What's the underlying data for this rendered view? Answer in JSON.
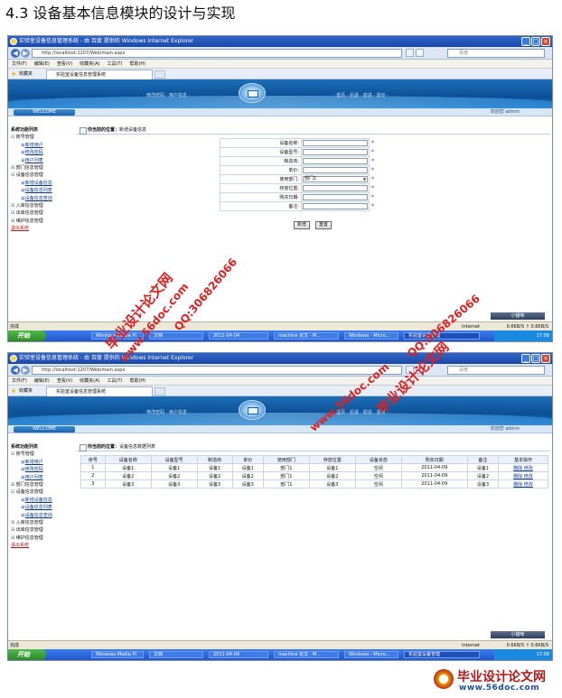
{
  "heading": "4.3 设备基本信息模块的设计与实现",
  "browser": {
    "window_title": "实验室设备信息管理系统 - 由 百度 提供的 Windows Internet Explorer",
    "address": "http://localhost:1207/Web/main.aspx",
    "search_placeholder": "百度",
    "menu": [
      "文件(F)",
      "编辑(E)",
      "查看(V)",
      "收藏夹(A)",
      "工具(T)",
      "帮助(H)"
    ],
    "favorites_label": "收藏夹",
    "tab_title": "实验室设备信息管理系统",
    "status_done": "完成",
    "zone": "Internet",
    "speed": "0.6KB/S  ↑ 0.6KB/S",
    "xiaomiao_label": "小猫咪",
    "start_label": "开始",
    "taskbar_items_1": [
      "Windows Media Pl",
      "文档",
      "2011-04-04",
      "machine 论文 - M...",
      "Windows - Micro...",
      "实验室设备管理"
    ],
    "taskbar_items_2": [
      "Windows Media Pl",
      "文档",
      "2011-04-04",
      "machine 论文 - M...",
      "Windows - Micro...",
      "实验室设备管理"
    ],
    "clock": "17:58"
  },
  "app": {
    "nav_left": "· 修改密码 · 用户信息 ·",
    "nav_right": "· 首页 · 后退 · 前进 · 退出 ·",
    "welcome": "WELCOME",
    "hello": "欢迎您 admin",
    "sidebar": {
      "header": "系统功能列表",
      "groups": [
        {
          "label": "账号管理",
          "open": true,
          "subs": [
            "新增用户",
            "修改密码",
            "用户列表"
          ]
        },
        {
          "label": "部门信息管理",
          "open": false,
          "subs": []
        },
        {
          "label": "设备信息管理",
          "open": true,
          "subs": [
            "新增设备信息",
            "设备信息列表",
            "设备信息查询"
          ]
        },
        {
          "label": "入库信息管理",
          "open": false,
          "subs": []
        },
        {
          "label": "出库信息管理",
          "open": false,
          "subs": []
        },
        {
          "label": "维护信息管理",
          "open": false,
          "subs": []
        }
      ],
      "logout": "退出系统"
    }
  },
  "screen1": {
    "location_prefix": "你当前的位置：",
    "location": "新增设备信息",
    "fields": [
      {
        "label": "设备名称:",
        "value": "",
        "type": "text"
      },
      {
        "label": "设备型号:",
        "value": "",
        "type": "text"
      },
      {
        "label": "制造商:",
        "value": "",
        "type": "text"
      },
      {
        "label": "单价:",
        "value": "",
        "type": "text"
      },
      {
        "label": "使用部门:",
        "value": "部门1",
        "type": "select"
      },
      {
        "label": "存放位置:",
        "value": "",
        "type": "text"
      },
      {
        "label": "购买日期:",
        "value": "",
        "type": "text"
      },
      {
        "label": "备注:",
        "value": "",
        "type": "text"
      }
    ],
    "required_mark": "*",
    "add_button": "新增",
    "reset_button": "重置"
  },
  "screen2": {
    "location_prefix": "你当前的位置：",
    "location": "设备信息数据列表",
    "columns": [
      "序号",
      "设备名称",
      "设备型号",
      "制造商",
      "单价",
      "使用部门",
      "存放位置",
      "设备状态",
      "购买日期",
      "备注",
      "基本操作"
    ],
    "rows": [
      [
        "1",
        "设备1",
        "设备1",
        "设备1",
        "设备1",
        "部门1",
        "设备1",
        "空闲",
        "2011-04-09",
        "设备1",
        "删除 修改"
      ],
      [
        "2",
        "设备2",
        "设备2",
        "设备2",
        "设备2",
        "部门1",
        "设备2",
        "空闲",
        "2011-04-09",
        "设备2",
        "删除 修改"
      ],
      [
        "3",
        "设备3",
        "设备3",
        "设备3",
        "设备3",
        "部门1",
        "设备3",
        "空闲",
        "2011-04-09",
        "设备3",
        "删除 修改"
      ]
    ]
  },
  "watermarks": {
    "site": "www.56doc.com",
    "name": "毕业设计论文网",
    "qq": "QQ:306826066"
  },
  "brand": {
    "name": "毕业设计论文网",
    "url": "www.56doc.com"
  }
}
